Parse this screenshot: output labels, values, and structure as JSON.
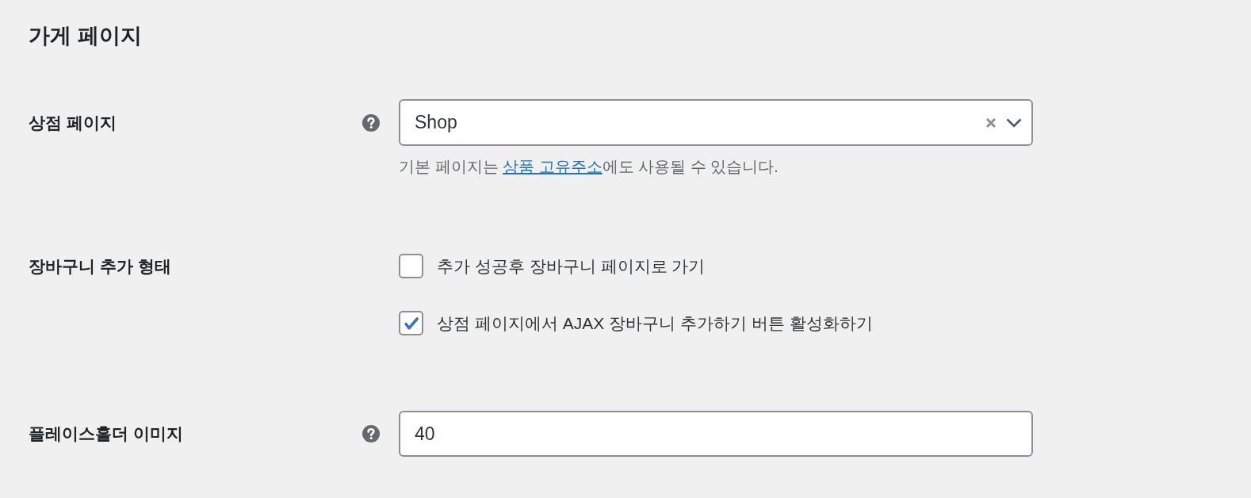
{
  "page_title": "가게 페이지",
  "settings": [
    {
      "kind": "select",
      "label": "상점 페이지",
      "help_icon": true,
      "value": "Shop",
      "clearable": true,
      "description": {
        "before": "기본 페이지는 ",
        "link": "상품 고유주소",
        "after": "에도 사용될 수 있습니다."
      }
    },
    {
      "kind": "checkboxes",
      "label": "장바구니 추가 형태",
      "help_icon": false,
      "options": [
        {
          "label": "추가 성공후 장바구니 페이지로 가기",
          "checked": false
        },
        {
          "label": "상점 페이지에서 AJAX 장바구니 추가하기 버튼 활성화하기",
          "checked": true
        }
      ]
    },
    {
      "kind": "text",
      "label": "플레이스홀더 이미지",
      "help_icon": true,
      "value": "40"
    }
  ]
}
